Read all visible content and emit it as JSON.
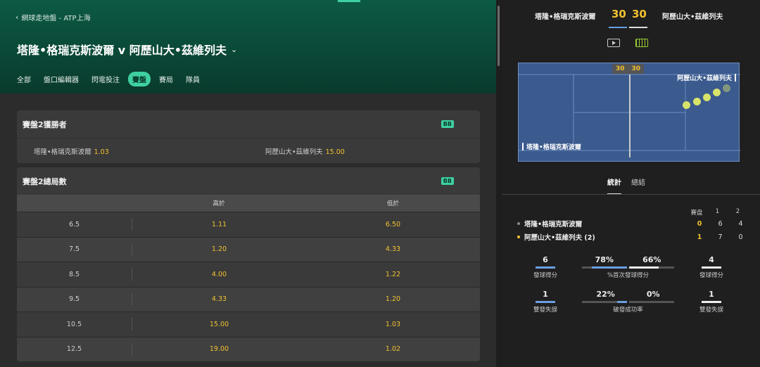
{
  "breadcrumb": "網球走地盤 - ATP上海",
  "match": {
    "title": "塔隆•格瑞克斯波爾 v 阿歷山大•茲維列夫",
    "dropdown_icon": "chevron-down-icon"
  },
  "tabs": [
    {
      "label": "全部"
    },
    {
      "label": "盤口編輯器"
    },
    {
      "label": "閃電投注"
    },
    {
      "label": "賽盤",
      "active": true
    },
    {
      "label": "賽局"
    },
    {
      "label": "隊員"
    }
  ],
  "market1": {
    "title": "賽盤2獲勝者",
    "badge": "BB",
    "selections": [
      {
        "name": "塔隆•格瑞克斯波爾",
        "odds": "1.03"
      },
      {
        "name": "阿歷山大•茲維列夫",
        "odds": "15.00"
      }
    ]
  },
  "market2": {
    "title": "賽盤2總局數",
    "badge": "BB",
    "col_over": "高於",
    "col_under": "低於",
    "rows": [
      {
        "line": "6.5",
        "over": "1.11",
        "under": "6.50"
      },
      {
        "line": "7.5",
        "over": "1.20",
        "under": "4.33"
      },
      {
        "line": "8.5",
        "over": "4.00",
        "under": "1.22"
      },
      {
        "line": "9.5",
        "over": "4.33",
        "under": "1.20"
      },
      {
        "line": "10.5",
        "over": "15.00",
        "under": "1.03"
      },
      {
        "line": "12.5",
        "over": "19.00",
        "under": "1.02"
      }
    ]
  },
  "scoreboard": {
    "player1": "塔隆•格瑞克斯波爾",
    "player2": "阿歷山大•茲維列夫",
    "score1": "30",
    "score2": "30",
    "view_icons": [
      "play-video-icon",
      "court-view-icon"
    ]
  },
  "court": {
    "score1": "30",
    "score2": "30",
    "player1": "塔隆•格瑞克斯波爾",
    "player2": "阿歷山大•茲維列夫"
  },
  "stat_tabs": [
    {
      "label": "統計",
      "active": true
    },
    {
      "label": "總結"
    }
  ],
  "sets_table": {
    "headers": [
      "賽盘",
      "1",
      "2"
    ],
    "rows": [
      {
        "name": "塔隆•格瑞克斯波爾",
        "current": "0",
        "s1": "6",
        "s2": "4",
        "dot": "#888888"
      },
      {
        "name": "阿歷山大•茲維列夫 (2)",
        "current": "1",
        "s1": "7",
        "s2": "0",
        "dot": "#f2c230"
      }
    ]
  },
  "stats": {
    "aces_left": "6",
    "aces_label_left": "發球得分",
    "first_serve_left": "78%",
    "first_serve_right": "66%",
    "first_serve_label": "%首次發球得分",
    "aces_right": "4",
    "aces_label_right": "發球得分",
    "df_left": "1",
    "df_label_left": "雙發失誤",
    "bp_left": "22%",
    "bp_right": "0%",
    "bp_label": "破發成功率",
    "df_right": "1",
    "df_label_right": "雙發失誤"
  },
  "colors": {
    "accent": "#3fd0a2",
    "odds": "#f2c230",
    "header_green": "#0c5a44"
  }
}
